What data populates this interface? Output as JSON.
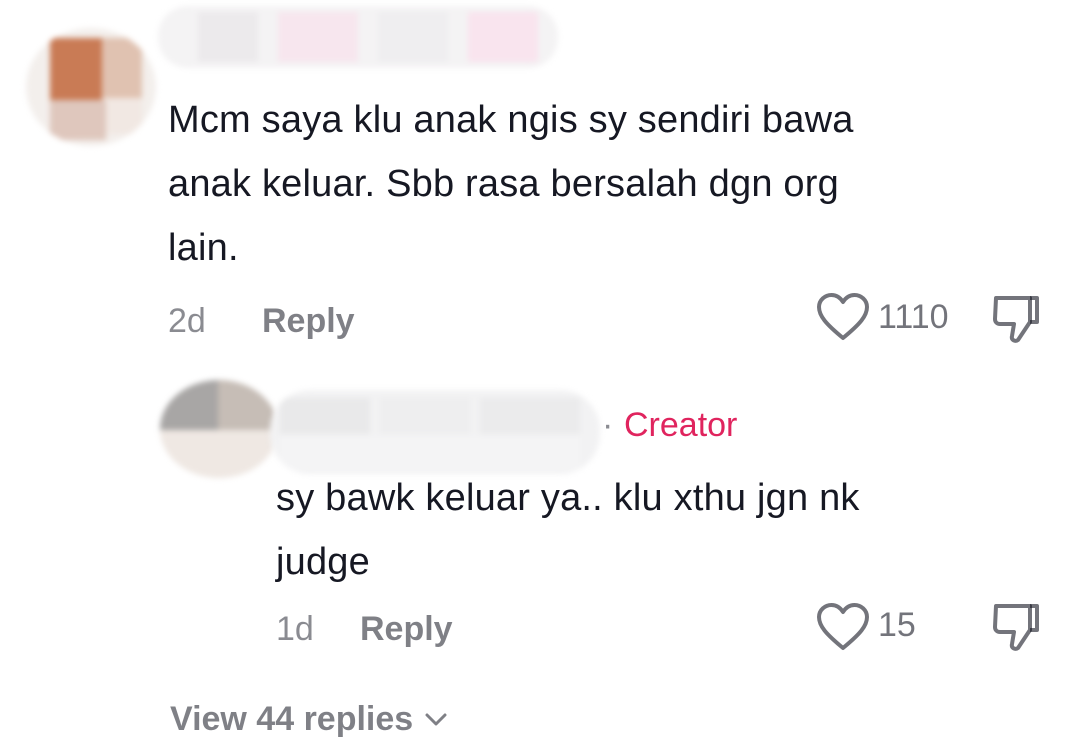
{
  "comments": [
    {
      "text_lines": [
        "Mcm saya klu anak ngis sy sendiri bawa",
        "anak keluar. Sbb rasa bersalah dgn org",
        "lain."
      ],
      "age": "2d",
      "reply_label": "Reply",
      "likes": "1110",
      "like_icon": "heart-outline-icon",
      "dislike_icon": "thumbs-down-icon"
    },
    {
      "creator_badge": "Creator",
      "separator": "·",
      "text_lines": [
        "sy bawk keluar ya.. klu xthu jgn nk",
        "judge"
      ],
      "age": "1d",
      "reply_label": "Reply",
      "likes": "15",
      "like_icon": "heart-outline-icon",
      "dislike_icon": "thumbs-down-icon"
    }
  ],
  "view_replies": "View 44 replies",
  "colors": {
    "text": "#161823",
    "muted": "#8a8b91",
    "creator": "#e0245e"
  }
}
